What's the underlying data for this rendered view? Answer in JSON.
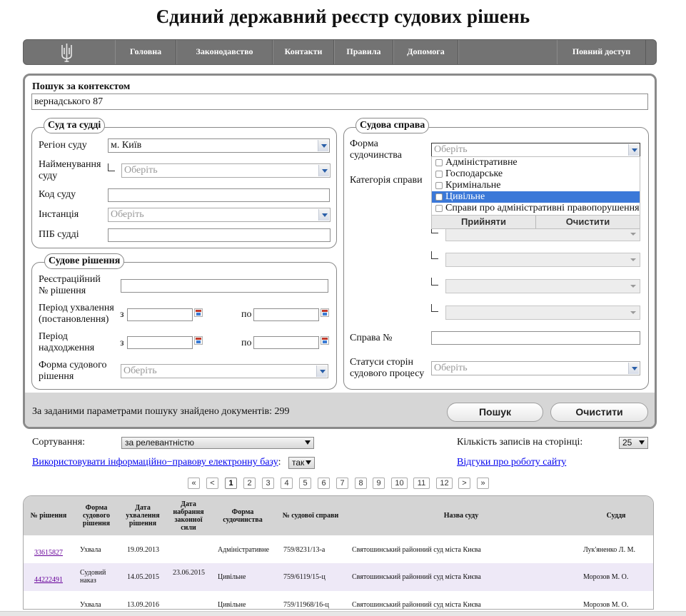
{
  "site": {
    "title": "Єдиний державний реєстр судових рішень"
  },
  "nav": {
    "items": [
      "Головна",
      "Законодавство",
      "Контакти",
      "Правила",
      "Допомога"
    ],
    "full_access": "Повний доступ"
  },
  "context_search": {
    "label": "Пошук за контекстом",
    "value": "вернадського 87"
  },
  "court": {
    "legend": "Суд та судді",
    "region_label": "Регіон суду",
    "region_value": "м. Київ",
    "name_label_1": "Найменування",
    "name_label_2": "суду",
    "name_placeholder": "Оберіть",
    "code_label": "Код суду",
    "code_value": "",
    "instance_label": "Інстанція",
    "instance_placeholder": "Оберіть",
    "judge_label": "ПІБ судді",
    "judge_value": ""
  },
  "decision": {
    "legend": "Судове рішення",
    "reg_label_1": "Реєстраційний",
    "reg_label_2": "№ рішення",
    "reg_value": "",
    "adopt_label_1": "Період ухвалення",
    "adopt_label_2": "(постановлення)",
    "receive_label_1": "Період",
    "receive_label_2": "надходження",
    "from": "з",
    "to": "по",
    "form_label_1": "Форма судового",
    "form_label_2": "рішення",
    "form_placeholder": "Оберіть"
  },
  "case": {
    "legend": "Судова справа",
    "proc_label_1": "Форма",
    "proc_label_2": "судочинства",
    "proc_placeholder": "Оберіть",
    "category_label": "Категорія справи",
    "case_no_label": "Справа №",
    "case_no_value": "",
    "status_label_1": "Статуси сторін",
    "status_label_2": "судового процесу",
    "status_placeholder": "Оберіть"
  },
  "proc_dropdown": {
    "options": [
      "Адміністративне",
      "Господарське",
      "Кримінальне",
      "Цивільне",
      "Справи про адміністративні правопорушення"
    ],
    "selected_index": 3,
    "accept": "Прийняти",
    "clear": "Очистити"
  },
  "results": {
    "found_text": "За заданими параметрами пошуку знайдено документів: 299",
    "search_button": "Пошук",
    "clear_button": "Очистити"
  },
  "options_bar": {
    "sort_label": "Сортування:",
    "sort_value": "за релевантністю",
    "per_page_label": "Кількість записів на сторінці:",
    "per_page_value": "25",
    "legal_base_link": "Використовувати інформаційно−правову електронну базу",
    "legal_base_colon": ":",
    "legal_base_value": "так",
    "feedback_link": "Відгуки про роботу сайту"
  },
  "pager": [
    "«",
    "<",
    "1",
    "2",
    "3",
    "4",
    "5",
    "6",
    "7",
    "8",
    "9",
    "10",
    "11",
    "12",
    ">",
    "»"
  ],
  "table": {
    "headers": [
      "№ рішення",
      "Форма судового рішення",
      "Дата ухвалення рішення",
      "Дата набрання законної сили",
      "Форма судочинства",
      "№ судової справи",
      "Назва суду",
      "Суддя"
    ],
    "rows": [
      {
        "num": "33615827",
        "form": "Ухвала",
        "date": "19.09.2013",
        "legal": "",
        "proc": "Адміністративне",
        "case": "759/8231/13-а",
        "court": "Святошинський районний суд міста Києва",
        "judge": "Лук'яненко Л. М."
      },
      {
        "num": "44222491",
        "form": "Судовий наказ",
        "date": "14.05.2015",
        "legal": "23.06.2015",
        "proc": "Цивільне",
        "case": "759/6119/15-ц",
        "court": "Святошинський районний суд міста Києва",
        "judge": "Морозов М. О."
      },
      {
        "num": "",
        "form": "Ухвала",
        "date": "13.09.2016",
        "legal": "",
        "proc": "Цивільне",
        "case": "759/11968/16-ц",
        "court": "Святошинський районний суд міста Києва",
        "judge": "Морозов М. О."
      }
    ]
  }
}
